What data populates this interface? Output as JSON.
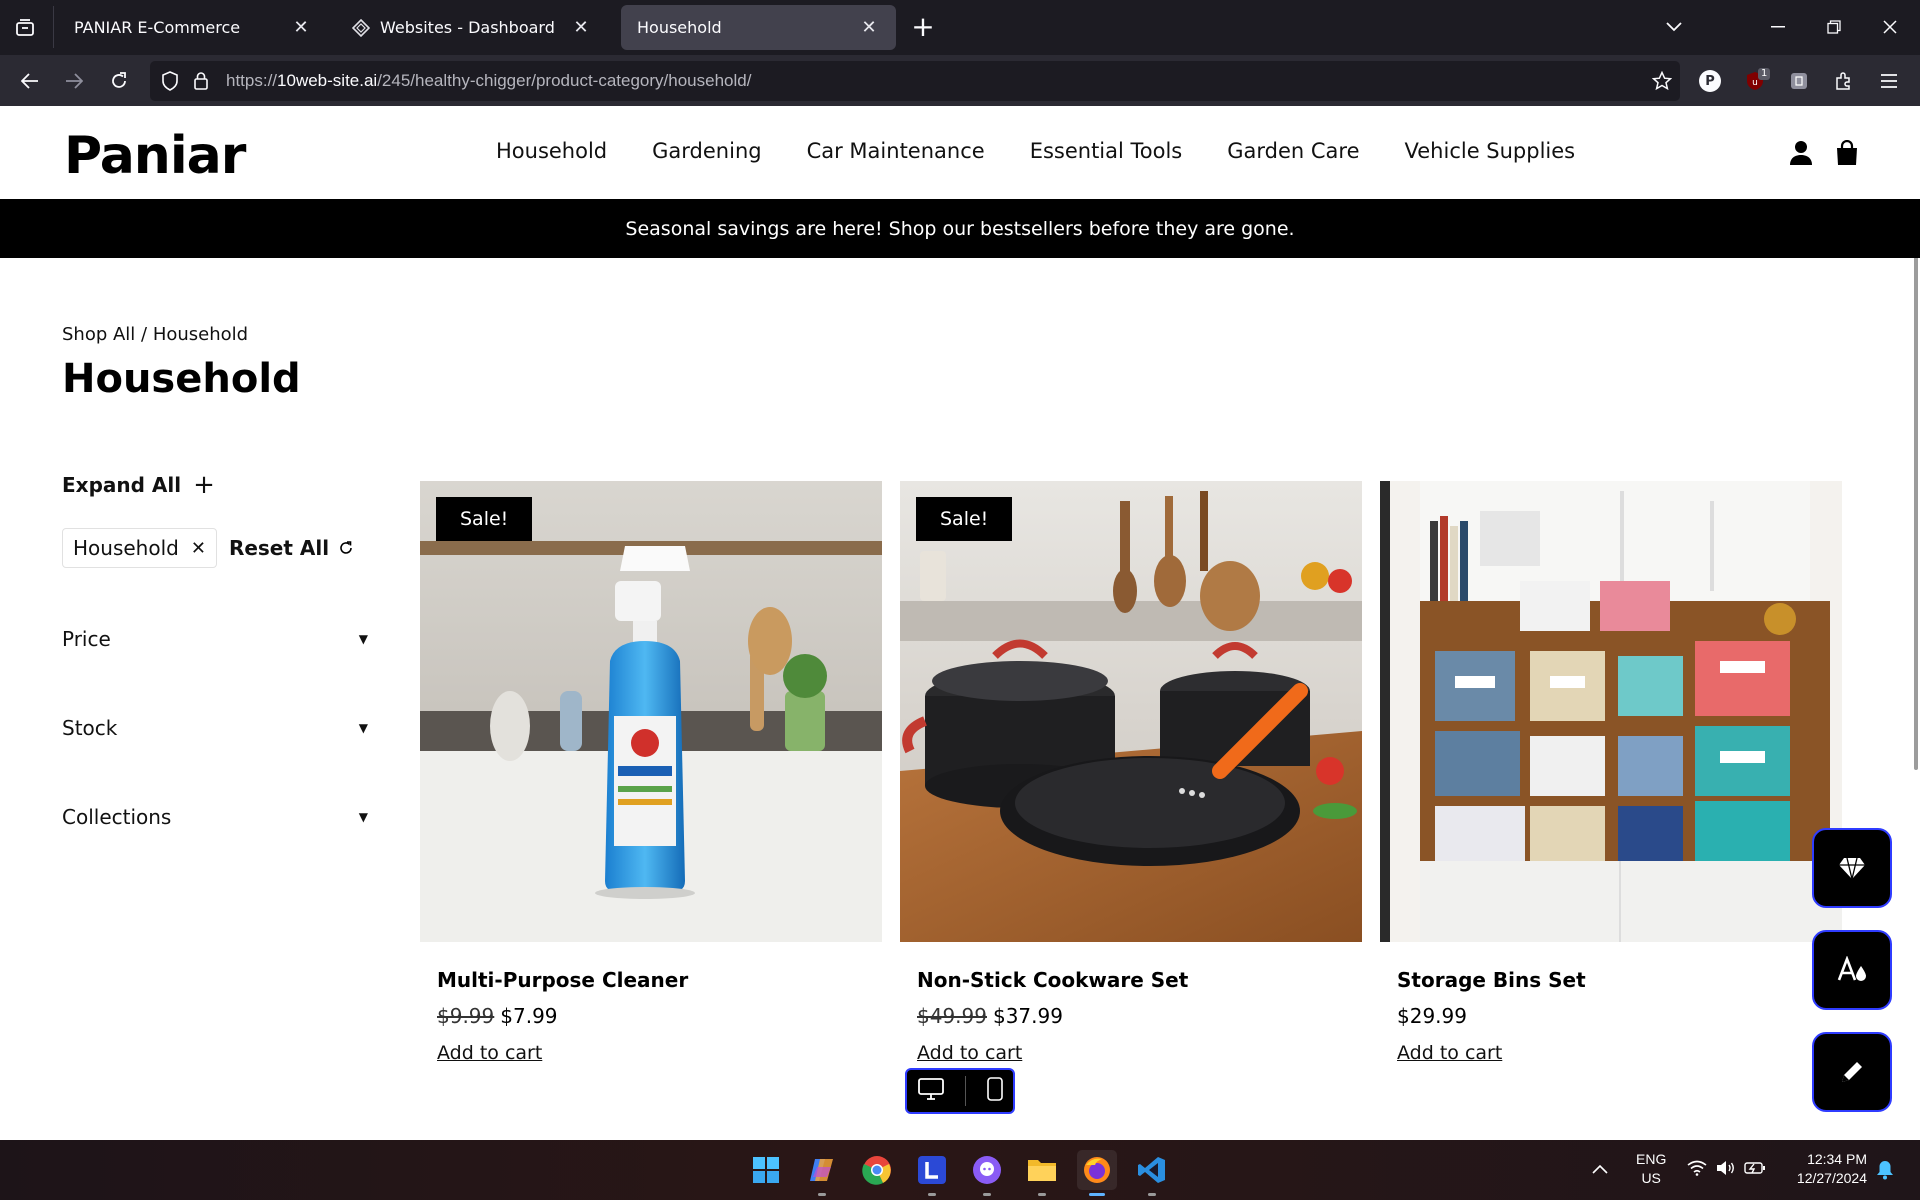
{
  "browser": {
    "tabs": [
      {
        "title": "PANIAR E-Commerce",
        "active": false
      },
      {
        "title": "Websites - Dashboard",
        "active": false
      },
      {
        "title": "Household",
        "active": true
      }
    ],
    "url_prefix": "https://",
    "url_host": "10web-site.ai",
    "url_path": "/245/healthy-chigger/product-category/household/",
    "extension_p_label": "P",
    "extension_badge": "1"
  },
  "site": {
    "logo": "Paniar",
    "nav": [
      "Household",
      "Gardening",
      "Car Maintenance",
      "Essential Tools",
      "Garden Care",
      "Vehicle Supplies"
    ],
    "promo": "Seasonal savings are here! Shop our bestsellers before they are gone."
  },
  "breadcrumb": {
    "root": "Shop All",
    "sep": " / ",
    "current": "Household"
  },
  "page_title": "Household",
  "sidebar": {
    "expand_all": "Expand All",
    "active_filter": "Household",
    "reset_all": "Reset All",
    "facets": [
      "Price",
      "Stock",
      "Collections"
    ]
  },
  "products": [
    {
      "name": "Multi-Purpose Cleaner",
      "old_price": "$9.99",
      "price": "$7.99",
      "sale": "Sale!",
      "cta": "Add to cart"
    },
    {
      "name": "Non-Stick Cookware Set",
      "old_price": "$49.99",
      "price": "$37.99",
      "sale": "Sale!",
      "cta": "Add to cart"
    },
    {
      "name": "Storage Bins Set",
      "old_price": "",
      "price": "$29.99",
      "sale": "",
      "cta": "Add to cart"
    }
  ],
  "taskbar": {
    "lang_line1": "ENG",
    "lang_line2": "US",
    "time": "12:34 PM",
    "date": "12/27/2024"
  },
  "colors": {
    "accent_border": "#2f3cff",
    "promo_bg": "#000000",
    "active_tab_bg": "#42414d"
  }
}
